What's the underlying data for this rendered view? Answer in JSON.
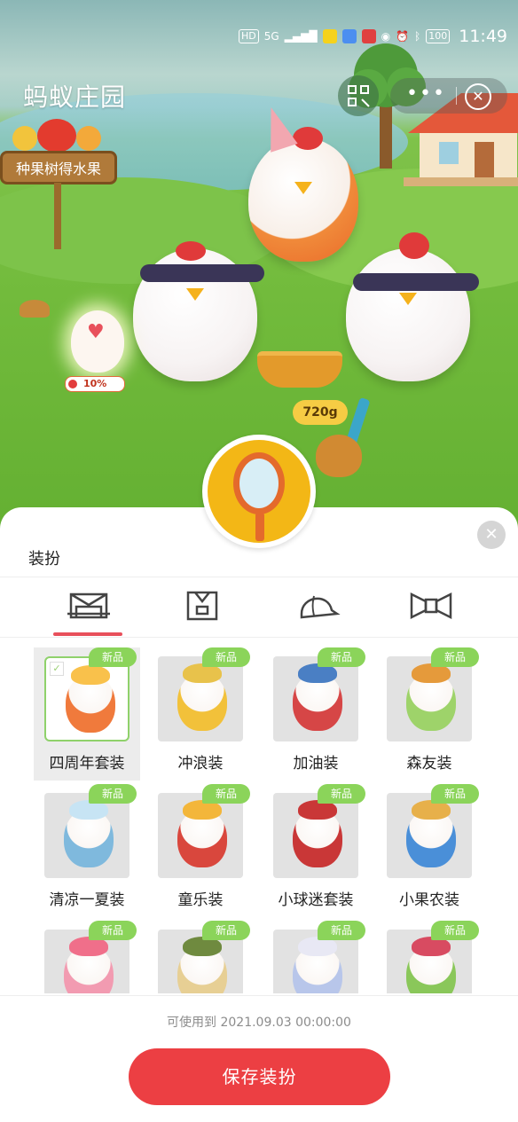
{
  "status_bar": {
    "hd": "HD",
    "signal": "5G",
    "battery": "100",
    "time": "11:49"
  },
  "app": {
    "title": "蚂蚁庄园"
  },
  "scene": {
    "sign_text": "种果树得水果",
    "egg_progress": "10%",
    "feed_amount": "720g"
  },
  "panel": {
    "title": "装扮",
    "tabs": [
      {
        "name": "suit",
        "icon": "suit-icon"
      },
      {
        "name": "clothes",
        "icon": "shirt-icon"
      },
      {
        "name": "hat",
        "icon": "hat-icon"
      },
      {
        "name": "bow",
        "icon": "bow-icon"
      }
    ],
    "badge_text": "新品",
    "items": [
      {
        "label": "四周年套装",
        "color": "#f07a3c",
        "top": "#f9c14b",
        "selected": true
      },
      {
        "label": "冲浪装",
        "color": "#f2c13a",
        "top": "#e8c24b"
      },
      {
        "label": "加油装",
        "color": "#d64646",
        "top": "#4a7fc4"
      },
      {
        "label": "森友装",
        "color": "#9ed36a",
        "top": "#e59a3b"
      },
      {
        "label": "清凉一夏装",
        "color": "#7fb9dd",
        "top": "#c7e4f4"
      },
      {
        "label": "童乐装",
        "color": "#d9473d",
        "top": "#f3b63a"
      },
      {
        "label": "小球迷套装",
        "color": "#c93737",
        "top": "#c93737"
      },
      {
        "label": "小果农装",
        "color": "#4a8fd8",
        "top": "#e7b04a"
      },
      {
        "label": "",
        "color": "#f29bb1",
        "top": "#f06f8a"
      },
      {
        "label": "",
        "color": "#e7cf94",
        "top": "#6f8a3f"
      },
      {
        "label": "",
        "color": "#b8c6ea",
        "top": "#e8e8f4"
      },
      {
        "label": "",
        "color": "#8ac75a",
        "top": "#d84b61"
      }
    ]
  },
  "footer": {
    "valid_until": "可使用到 2021.09.03 00:00:00",
    "save_label": "保存装扮"
  }
}
